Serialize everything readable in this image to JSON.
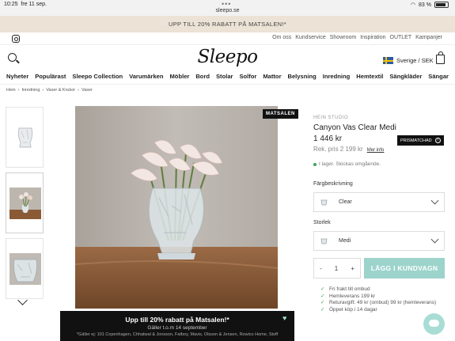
{
  "status_bar": {
    "time": "10:25",
    "date": "fre 11 sep.",
    "url": "sleepo.se",
    "battery": "83 %"
  },
  "promo_bar": {
    "text": "UPP TILL 20% RABATT PÅ MATSALEN!*"
  },
  "top_links": [
    "Om oss",
    "Kundservice",
    "Showroom",
    "Inspiration",
    "OUTLET",
    "Kampanjer"
  ],
  "header": {
    "logo": "Sleepo",
    "region": "Sverige / SEK"
  },
  "nav": [
    "Nyheter",
    "Populärast",
    "Sleepo Collection",
    "Varumärken",
    "Möbler",
    "Bord",
    "Stolar",
    "Solfor",
    "Mattor",
    "Belysning",
    "Inredning",
    "Hemtextil",
    "Sängkläder",
    "Sängar"
  ],
  "breadcrumb": [
    "Hem",
    "Inredning",
    "Vaser & Krukor",
    "Vaser"
  ],
  "product_badge": "MATSALEN",
  "product": {
    "brand": "HEIN STUDIO",
    "name": "Canyon Vas Clear Medi",
    "price": "1 446 kr",
    "prismatch": "PRISMATCHAD",
    "rek_price": "Rek. pris 2 199 kr",
    "more_info": "Mer info",
    "stock": "I lager. Skickas omgående.",
    "color_label": "Färgbeskrivning",
    "color_value": "Clear",
    "size_label": "Storlek",
    "size_value": "Medi",
    "qty_minus": "-",
    "quantity": "1",
    "qty_plus": "+",
    "add_to_cart": "LÄGG I KUNDVAGN"
  },
  "usps": [
    "Fri frakt till ombud",
    "Hemleverans 199 kr",
    "Returavgift: 49 kr (ombud) 99 kr (hemleverans)",
    "Öppet köp i 14 dagar"
  ],
  "banner": {
    "title": "Upp till 20% rabatt på Matsalen!*",
    "subtitle": "Gäller t.o.m 14 september",
    "fineprint": "*Gäller ej: 101 Copenhagen, Chhatwal & Jonsson, Fatboy, Mavis, Olsson & Jensen, Rowico Home, Stoff"
  },
  "colors": {
    "accent": "#9cd3cb",
    "promo_bg": "#ece2d6",
    "dark": "#111111"
  }
}
